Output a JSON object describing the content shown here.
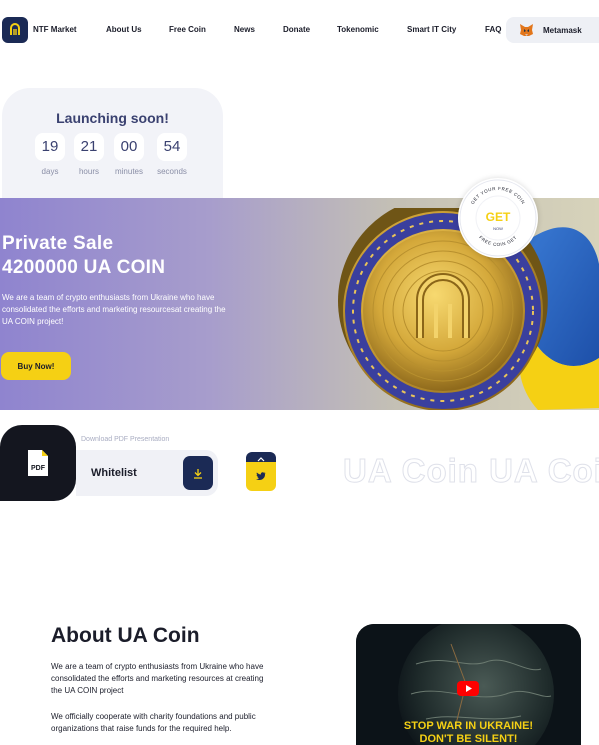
{
  "nav": {
    "brand": "NTF Market",
    "items": [
      "About Us",
      "Free Coin",
      "News",
      "Donate",
      "Tokenomic",
      "Smart IT City",
      "FAQ"
    ],
    "wallet_label": "Metamask"
  },
  "countdown": {
    "title": "Launching soon!",
    "units": [
      {
        "value": "19",
        "label": "days"
      },
      {
        "value": "21",
        "label": "hours"
      },
      {
        "value": "00",
        "label": "minutes"
      },
      {
        "value": "54",
        "label": "seconds"
      }
    ]
  },
  "hero": {
    "title_line1": "Private Sale",
    "title_line2": "4200000 UA COIN",
    "description": "We are a team of crypto enthusiasts from Ukraine who have consolidated the efforts and marketing resourcesat creating the UA COIN project!",
    "buy_label": "Buy Now!",
    "badge_main": "GET",
    "badge_sub": "NOW",
    "badge_ring_top": "GET YOUR FREE COIN",
    "badge_ring_bottom": "FREE COIN GET"
  },
  "pdf": {
    "icon_text": "PDF",
    "caption": "Download PDF Presentation",
    "whitelist_label": "Whitelist"
  },
  "marquee": "UA Coin UA Coin",
  "about": {
    "title": "About UA Coin",
    "p1": "We are a team of crypto enthusiasts from Ukraine who have consolidated the efforts and marketing resources at creating the UA COIN project",
    "p2": "We officially cooperate with charity foundations and public organizations that raise funds for the required help.",
    "video_line1": "STOP WAR IN UKRAINE!",
    "video_line2": "DON'T BE SILENT!"
  },
  "colors": {
    "navy": "#1b2a55",
    "yellow": "#f5d014",
    "lavender": "#8f84cf",
    "light_panel": "#f2f3f8"
  }
}
